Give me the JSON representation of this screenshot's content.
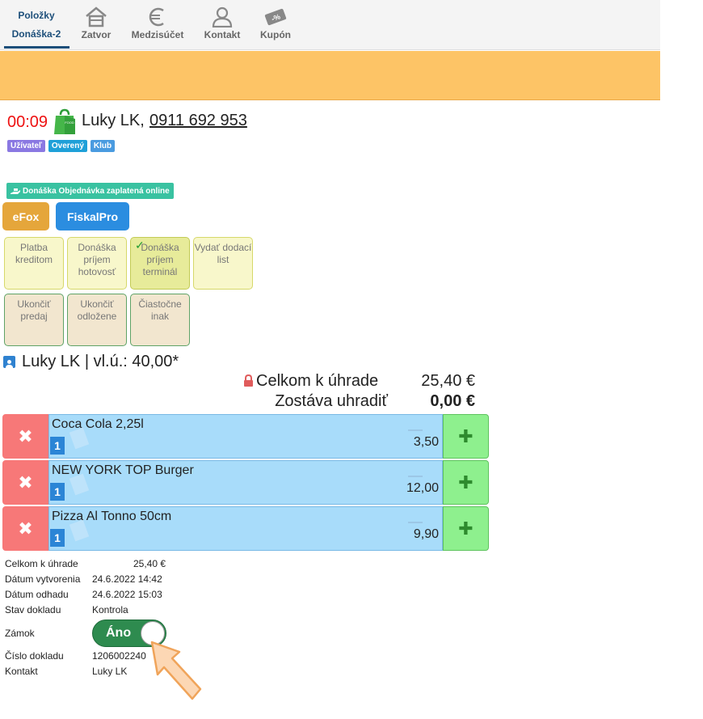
{
  "nav": {
    "active_top": "Položky",
    "active_bottom": "Donáška-2",
    "tabs": [
      {
        "label": "Zatvor",
        "icon": "house-icon"
      },
      {
        "label": "Medzisúčet",
        "icon": "euro-icon"
      },
      {
        "label": "Kontakt",
        "icon": "person-icon"
      },
      {
        "label": "Kupón",
        "icon": "coupon-icon"
      }
    ]
  },
  "header": {
    "timer": "00:09",
    "customer": "Luky LK,",
    "phone": "0911 692 953",
    "badges": [
      {
        "label": "Užívateľ",
        "color": "#8a78e2"
      },
      {
        "label": "Overený",
        "color": "#1fa0d8"
      },
      {
        "label": "Klub",
        "color": "#4a9be0"
      }
    ],
    "delivery_badge": "Donáška Objednávka zaplatená online"
  },
  "buttons": {
    "efox": "eFox",
    "fiskalpro": "FiskalPro"
  },
  "payments": {
    "row1": [
      "Platba kreditom",
      "Donáška príjem hotovosť",
      "Donáška príjem terminál",
      "Vydať dodací list"
    ],
    "row2": [
      "Ukončiť predaj",
      "Ukončiť odložene",
      "Čiastočne inak"
    ]
  },
  "client_line": "Luky LK | vl.ú.: 40,00*",
  "totals": {
    "total_label": "Celkom k úhrade",
    "total_value": "25,40 €",
    "remaining_label": "Zostáva uhradiť",
    "remaining_value": "0,00 €"
  },
  "items": [
    {
      "name": "Coca Cola 2,25l",
      "qty": "1",
      "price": "3,50"
    },
    {
      "name": "NEW YORK TOP Burger",
      "qty": "1",
      "price": "12,00"
    },
    {
      "name": "Pizza Al Tonno 50cm",
      "qty": "1",
      "price": "9,90"
    }
  ],
  "details": {
    "total_label": "Celkom k úhrade",
    "total_value": "25,40 €",
    "created_label": "Dátum vytvorenia",
    "created_value": "24.6.2022 14:42",
    "estimate_label": "Dátum odhadu",
    "estimate_value": "24.6.2022 15:03",
    "state_label": "Stav dokladu",
    "state_value": "Kontrola",
    "lock_label": "Zámok",
    "lock_value": "Áno",
    "docnum_label": "Číslo dokladu",
    "docnum_value": "1206002240",
    "contact_label": "Kontakt",
    "contact_value": "Luky LK"
  },
  "colors": {
    "banner": "#fdc466",
    "nav_active": "#1d4f7a",
    "timer": "#e11111",
    "item_body": "#a8dcfa",
    "delete": "#f77878",
    "add": "#8ef08e",
    "toggle_on": "#2e8b4f"
  }
}
